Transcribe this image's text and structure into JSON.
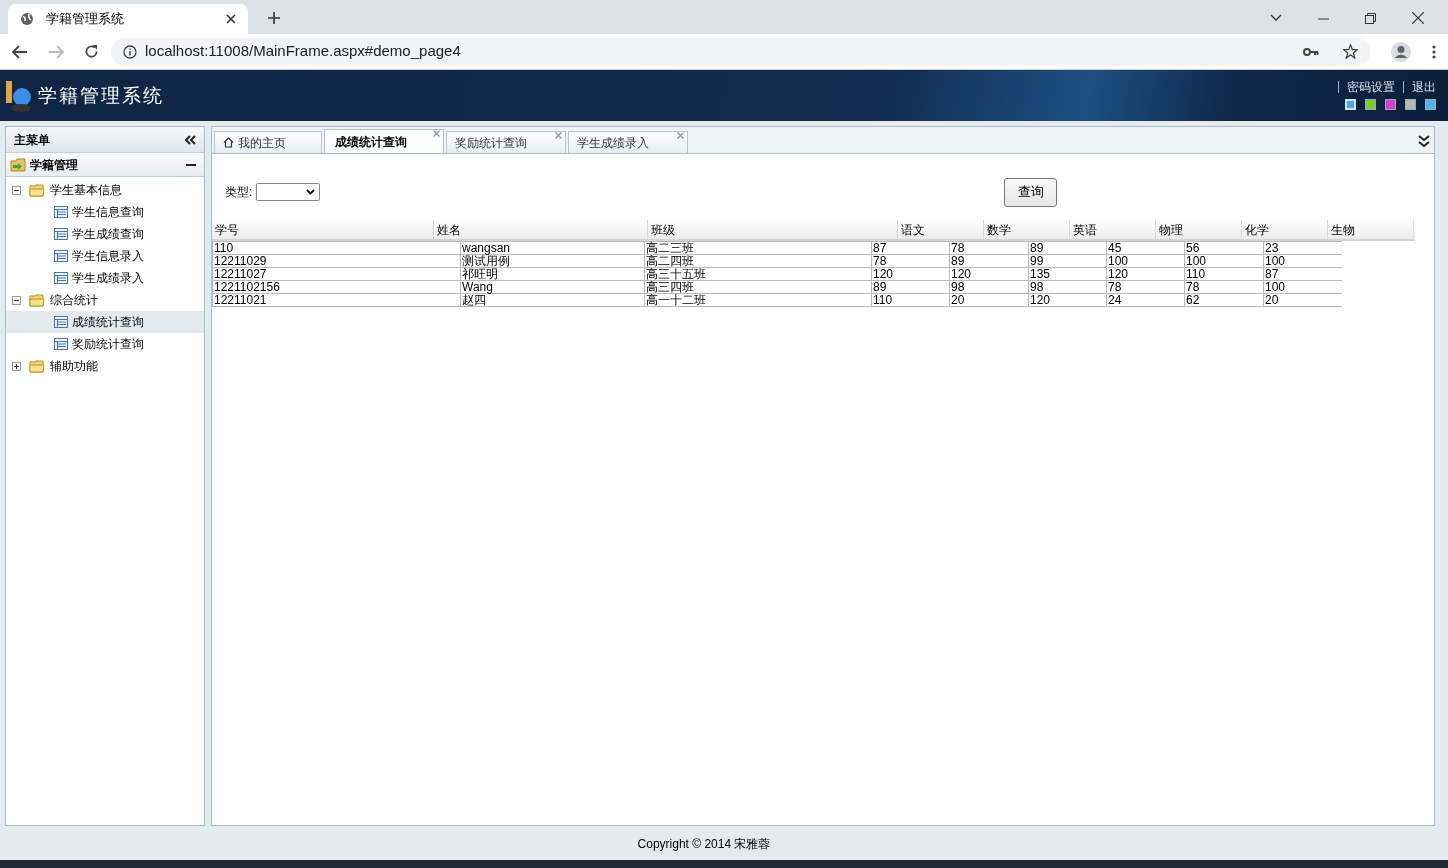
{
  "browser": {
    "tab_title": "学籍管理系统",
    "url": "localhost:11008/MainFrame.aspx#demo_page4"
  },
  "header": {
    "title": "学籍管理系统",
    "links": [
      "密码设置",
      "退出"
    ],
    "themes": [
      {
        "color": "#4fa3d8",
        "selected": true
      },
      {
        "color": "#7ccc2a",
        "selected": false
      },
      {
        "color": "#d93cc8",
        "selected": false
      },
      {
        "color": "#b5b5b5",
        "selected": false
      },
      {
        "color": "#47b6ee",
        "selected": false
      }
    ]
  },
  "sidebar": {
    "title": "主菜单",
    "section": "学籍管理",
    "tree": [
      {
        "label": "学生基本信息",
        "expanded": true,
        "children": [
          {
            "label": "学生信息查询",
            "selected": false
          },
          {
            "label": "学生成绩查询",
            "selected": false
          },
          {
            "label": "学生信息录入",
            "selected": false
          },
          {
            "label": "学生成绩录入",
            "selected": false
          }
        ]
      },
      {
        "label": "综合统计",
        "expanded": true,
        "children": [
          {
            "label": "成绩统计查询",
            "selected": true
          },
          {
            "label": "奖励统计查询",
            "selected": false
          }
        ]
      },
      {
        "label": "辅助功能",
        "expanded": false
      }
    ]
  },
  "tabs": [
    {
      "label": "我的主页",
      "kind": "home",
      "selected": false
    },
    {
      "label": "成绩统计查询",
      "kind": "closable",
      "selected": true
    },
    {
      "label": "奖励统计查询",
      "kind": "closable",
      "selected": false
    },
    {
      "label": "学生成绩录入",
      "kind": "closable",
      "selected": false
    }
  ],
  "filter": {
    "label": "类型:",
    "query_button": "查询"
  },
  "table": {
    "columns": [
      "学号",
      "姓名",
      "班级",
      "语文",
      "数学",
      "英语",
      "物理",
      "化学",
      "生物"
    ],
    "rows": [
      [
        "110",
        "wangsan",
        "高二三班",
        "87",
        "78",
        "89",
        "45",
        "56",
        "23"
      ],
      [
        "12211029",
        "测试用例",
        "高二四班",
        "78",
        "89",
        "99",
        "100",
        "100",
        "100"
      ],
      [
        "12211027",
        "祁旺明",
        "高三十五班",
        "120",
        "120",
        "135",
        "120",
        "110",
        "87"
      ],
      [
        "1221102156",
        "Wang",
        "高三四班",
        "89",
        "98",
        "98",
        "78",
        "78",
        "100"
      ],
      [
        "12211021",
        "赵四",
        "高一十二班",
        "110",
        "20",
        "120",
        "24",
        "62",
        "20"
      ]
    ]
  },
  "footer": "Copyright © 2014 宋雅蓉"
}
